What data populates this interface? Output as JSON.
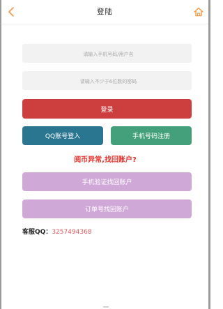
{
  "header": {
    "title": "登陆",
    "back_icon": "chevron-left-icon",
    "home_icon": "home-icon",
    "accent": "#f39b4a"
  },
  "form": {
    "username_placeholder": "请输入手机号码/用户名",
    "password_placeholder": "请输入不少于6位数的密码"
  },
  "buttons": {
    "login": "登录",
    "qq_login": "QQ账号登入",
    "register": "手机号码注册",
    "phone_recover": "手机验证找回账户",
    "order_recover": "订单号找回账户"
  },
  "recover_title": "阅币异常,找回账户?",
  "service": {
    "label": "客服QQ：",
    "qq": "3257494368"
  },
  "colors": {
    "login": "#cd3f3f",
    "qq": "#2a7690",
    "register": "#43a07a",
    "recover": "#d0a8d8",
    "title_red": "#e8302a"
  }
}
